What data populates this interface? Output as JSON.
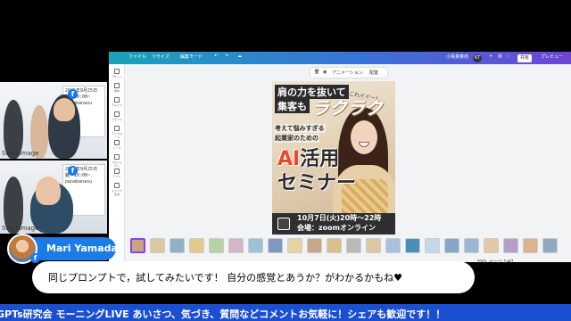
{
  "cams": {
    "cam1": {
      "poster_lines": [
        "2025年9月25日",
        "雑？10:00~",
        "panabanasu"
      ],
      "label": "Seed",
      "sub": "image"
    },
    "cam2": {
      "poster_lines": [
        "2025年9月25日",
        "雑？10:00~",
        "panabanasu"
      ],
      "label": "Seed",
      "sub": "image"
    }
  },
  "canva": {
    "topbar": {
      "items": [
        "ファイル",
        "リサイズ",
        "編集モード"
      ],
      "right_items": [
        "小塚貴菜商",
        "共有",
        "プレビュー"
      ],
      "avatar_initials": "KT"
    },
    "rail": [
      "デザイン",
      "素材",
      "テキスト",
      "ブランド",
      "アップロード",
      "ツール",
      "プロジェクト",
      "アプリ",
      "マジック生成"
    ],
    "context_bar": {
      "anim": "アニメーション",
      "pos": "配置"
    },
    "poster": {
      "head1": "肩の力を抜いて",
      "head2": "集客も",
      "big": "ラクラク",
      "note": "これイイー！",
      "sub1": "考えて悩みすぎる",
      "sub2": "起業家のための",
      "ai_red": "AI",
      "ai_black": "活用",
      "seminar": "セミナー",
      "date": "10月7日(火)20時～22時",
      "venue": "会場：zoomオンライン"
    },
    "zoom": {
      "percent": "59%",
      "pages_label": "ページ",
      "page_counter": "1/47"
    }
  },
  "presenter": {
    "name": "Mari Yamada"
  },
  "comment": {
    "text": "同じプロンプトで，試してみたいです！ 自分の感覚とあうか？がわかるかもね♥"
  },
  "ticker": {
    "text": "GPTs研究会 モーニングLIVE あいさつ、気づき、質問などコメントお気軽に！シェアも歓迎です！！"
  },
  "colors": {
    "canva_gradient_start": "#1aa3b8",
    "canva_gradient_end": "#6e45d3",
    "name_plate": "#1b7ce8",
    "ticker": "#1b4fd1",
    "ai_red": "#e8492b"
  }
}
